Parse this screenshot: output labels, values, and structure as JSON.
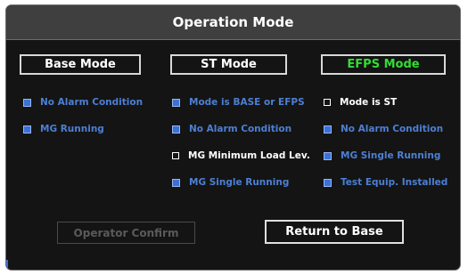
{
  "dialog": {
    "title": "Operation Mode"
  },
  "modes": {
    "base": {
      "label": "Base Mode",
      "color": "#ffffff"
    },
    "st": {
      "label": "ST Mode",
      "color": "#ffffff"
    },
    "efps": {
      "label": "EFPS Mode",
      "color": "#33dd33"
    }
  },
  "conditions": {
    "base": [
      {
        "text": "No Alarm Condition",
        "state": "blue"
      },
      {
        "text": "MG Running",
        "state": "blue"
      }
    ],
    "st": [
      {
        "text": "Mode is BASE or EFPS",
        "state": "blue"
      },
      {
        "text": "No Alarm Condition",
        "state": "blue"
      },
      {
        "text": "MG Minimum Load Lev.",
        "state": "white"
      },
      {
        "text": "MG Single Running",
        "state": "blue"
      }
    ],
    "efps": [
      {
        "text": "Mode is ST",
        "state": "white"
      },
      {
        "text": "No Alarm Condition",
        "state": "blue"
      },
      {
        "text": "MG Single Running",
        "state": "blue"
      },
      {
        "text": "Test Equip. Installed",
        "state": "blue"
      }
    ]
  },
  "buttons": {
    "operator_confirm": "Operator Confirm",
    "return_to_base": "Return to Base"
  },
  "colors": {
    "accent_blue": "#4d7fd4",
    "active_green": "#33dd33",
    "panel_bg": "#141414",
    "titlebar_bg": "#3f3f3f"
  }
}
